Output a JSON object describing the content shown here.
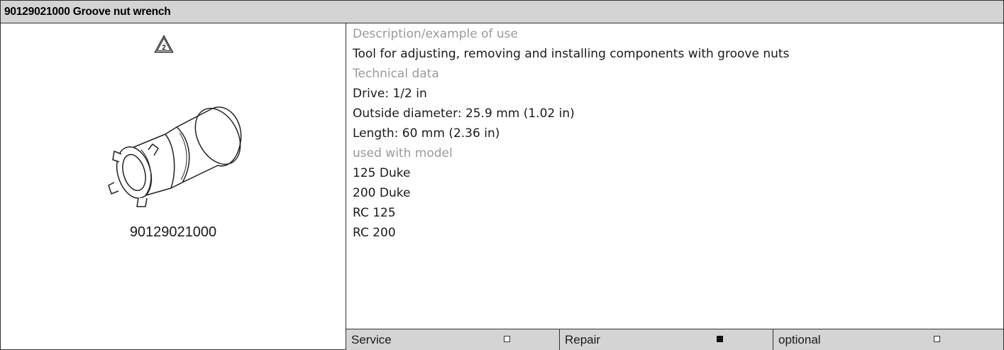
{
  "title": "90129021000 Groove nut wrench",
  "figure": {
    "warning_icon": "warning-triangle-2-icon",
    "warning_number": "2",
    "part_number": "90129021000"
  },
  "details": {
    "description_heading": "Description/example of use",
    "description": "Tool for adjusting, removing and installing components with groove nuts",
    "technical_heading": "Technical data",
    "technical": [
      "Drive: 1/2 in",
      "Outside diameter: 25.9 mm (1.02 in)",
      "Length: 60 mm (2.36 in)"
    ],
    "models_heading": "used with model",
    "models": [
      "125 Duke",
      "200 Duke",
      "RC 125",
      "RC 200"
    ]
  },
  "footer": {
    "service_label": "Service",
    "service_checked": false,
    "repair_label": "Repair",
    "repair_checked": true,
    "optional_label": "optional",
    "optional_checked": false
  }
}
